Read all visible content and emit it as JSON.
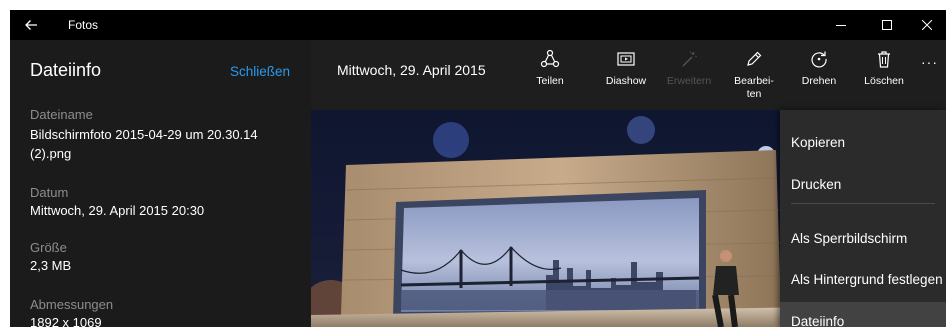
{
  "titlebar": {
    "app_name": "Fotos",
    "back_icon": "arrow-left-icon"
  },
  "info_panel": {
    "title": "Dateiinfo",
    "close_label": "Schließen",
    "fields": [
      {
        "label": "Dateiname",
        "value": "Bildschirmfoto 2015-04-29 um 20.30.14 (2).png"
      },
      {
        "label": "Datum",
        "value": "Mittwoch, 29. April 2015 20:30"
      },
      {
        "label": "Größe",
        "value": "2,3 MB"
      },
      {
        "label": "Abmessungen",
        "value": "1892 x 1069"
      }
    ]
  },
  "toolbar": {
    "date": "Mittwoch, 29. April 2015",
    "share": "Teilen",
    "slideshow": "Diashow",
    "enhance": "Erweitern",
    "edit_line1": "Bearbei-",
    "edit_line2": "ten",
    "rotate": "Drehen",
    "delete": "Löschen",
    "more": "···"
  },
  "menu": {
    "items": [
      {
        "label": "Kopieren"
      },
      {
        "label": "Drucken"
      },
      {
        "label": "Als Sperrbildschirm"
      },
      {
        "label": "Als Hintergrund festlegen"
      },
      {
        "label": "Dateiinfo"
      }
    ],
    "active_item": "Dateiinfo"
  },
  "colors": {
    "link": "#2a9bea",
    "panel_bg": "#1b1b1b",
    "toolbar_bg": "#1e1e1e",
    "menu_bg": "#2b2b2b",
    "menu_active_bg": "#424242"
  }
}
